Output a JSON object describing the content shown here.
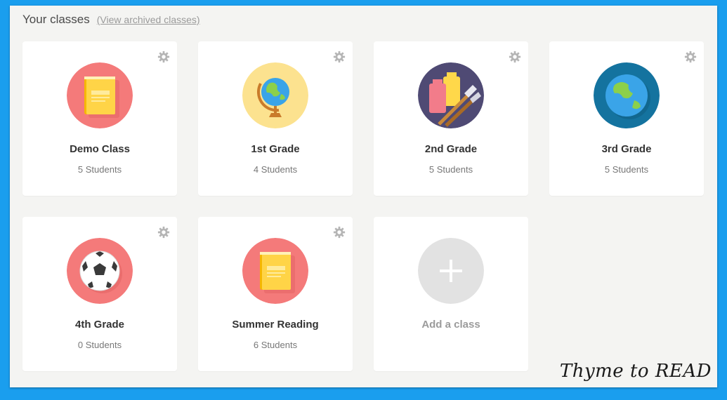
{
  "header": {
    "title": "Your classes",
    "archived_link": "(View archived classes)"
  },
  "classes": [
    {
      "name": "Demo Class",
      "students": "5 Students",
      "icon": "book-icon",
      "color": "#f47a7a"
    },
    {
      "name": "1st Grade",
      "students": "4 Students",
      "icon": "globe-icon",
      "color": "#fce28f"
    },
    {
      "name": "2nd Grade",
      "students": "5 Students",
      "icon": "paint-supplies-icon",
      "color": "#4f4a74"
    },
    {
      "name": "3rd Grade",
      "students": "5 Students",
      "icon": "earth-icon",
      "color": "#14739f"
    },
    {
      "name": "4th Grade",
      "students": "0 Students",
      "icon": "soccer-ball-icon",
      "color": "#f47a7a"
    },
    {
      "name": "Summer Reading",
      "students": "6 Students",
      "icon": "book-icon",
      "color": "#f47a7a"
    }
  ],
  "add_class": {
    "label": "Add a class",
    "icon": "plus-icon",
    "color": "#e2e2e2"
  },
  "card_settings_icon": "gear-icon",
  "watermark": "Thyme to READ",
  "colors": {
    "background": "#1a9eee",
    "panel": "#f4f4f2",
    "card": "#ffffff"
  }
}
